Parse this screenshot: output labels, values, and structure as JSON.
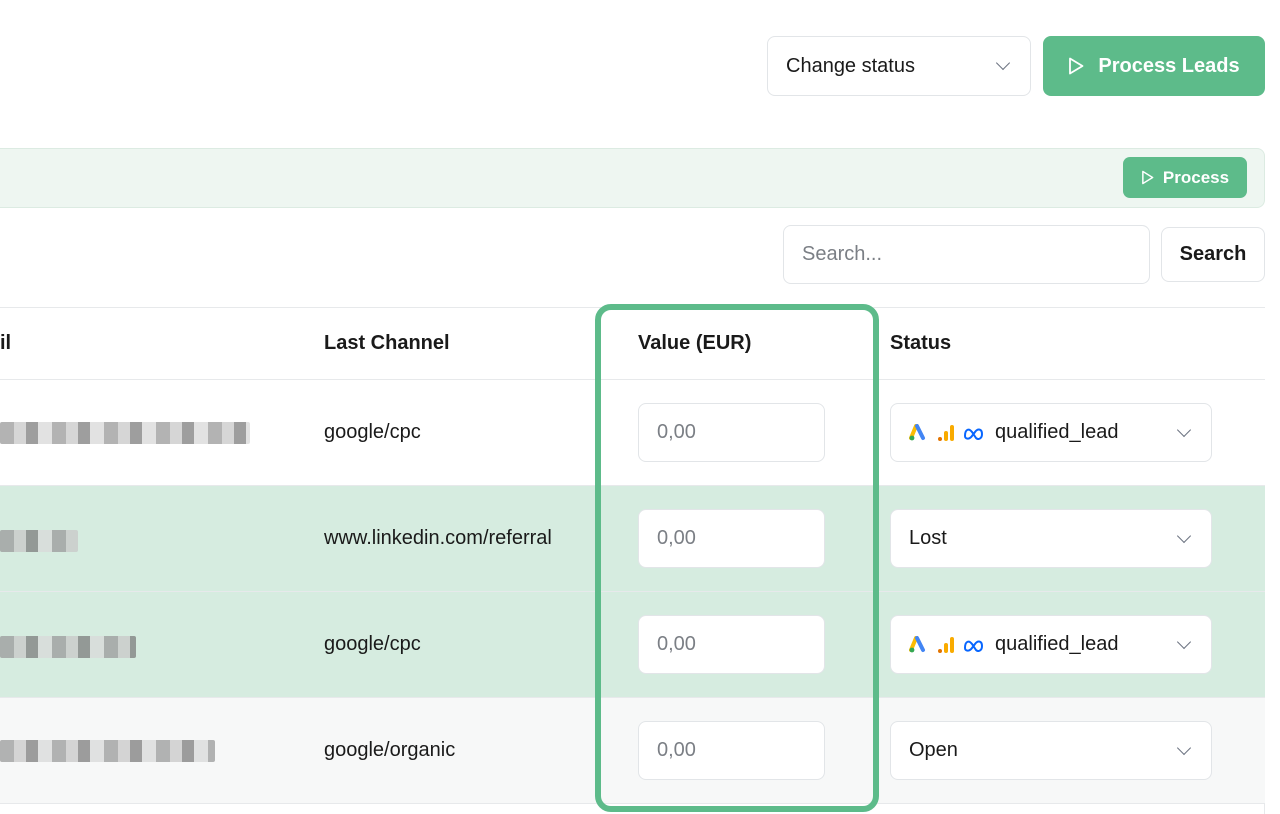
{
  "toolbar": {
    "change_status_label": "Change status",
    "process_leads_label": "Process Leads"
  },
  "banner": {
    "process_label": "Process"
  },
  "search": {
    "placeholder": "Search...",
    "button_label": "Search"
  },
  "table": {
    "columns": {
      "email": "il",
      "last_channel": "Last Channel",
      "value": "Value (EUR)",
      "status": "Status"
    },
    "rows": [
      {
        "channel": "google/cpc",
        "value_placeholder": "0,00",
        "status": "qualified_lead",
        "status_icons": [
          "google-ads-icon",
          "google-analytics-icon",
          "meta-icon"
        ],
        "background": "#ffffff"
      },
      {
        "channel": "www.linkedin.com/referral",
        "value_placeholder": "0,00",
        "status": "Lost",
        "status_icons": [],
        "background": "#d6ece0"
      },
      {
        "channel": "google/cpc",
        "value_placeholder": "0,00",
        "status": "qualified_lead",
        "status_icons": [
          "google-ads-icon",
          "google-analytics-icon",
          "meta-icon"
        ],
        "background": "#d6ece0"
      },
      {
        "channel": "google/organic",
        "value_placeholder": "0,00",
        "status": "Open",
        "status_icons": [],
        "background": "#f7f8f8"
      }
    ]
  },
  "colors": {
    "accent": "#5dbb8a",
    "highlight_border": "#5dbb8a",
    "row_selected": "#d6ece0",
    "banner_bg": "#eef6f1"
  }
}
